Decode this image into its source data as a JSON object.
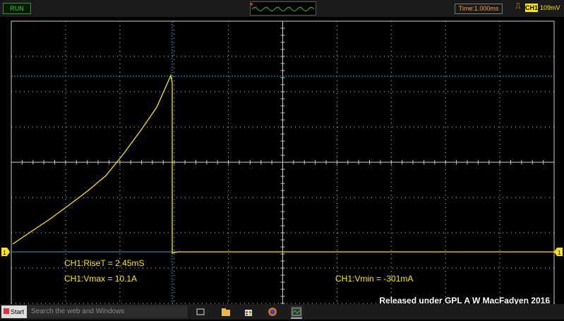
{
  "toolbar": {
    "status": "RUN",
    "timebase": "Time:1.000ms",
    "trigger_channel": "CH1",
    "volts_per_div": "109mV"
  },
  "channel_marker": "1",
  "measurements": {
    "rise_time": "CH1:RiseT = 2.45mS",
    "vmax": "CH1:Vmax = 10.1A",
    "vmin": "CH1:Vmin = -301mA"
  },
  "credit": "Released under GPL  A W MacFadyen 2016",
  "taskbar": {
    "start_label": "Start",
    "search_placeholder": "Search the web and Windows",
    "icons": [
      "task-view-icon",
      "file-explorer-icon",
      "store-icon",
      "firefox-icon",
      "oscilloscope-app-icon"
    ]
  },
  "colors": {
    "trace": "#ffe600",
    "grid": "#cfcfcf",
    "cursor": "#2a9fd6",
    "run": "#2bd12b",
    "timebase": "#ff9a2e"
  }
}
